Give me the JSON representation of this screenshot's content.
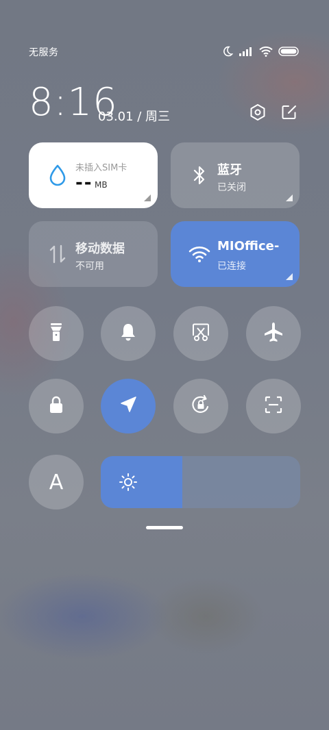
{
  "status_bar": {
    "carrier": "无服务",
    "icons": [
      "moon-icon",
      "signal-icon",
      "wifi-icon",
      "battery-icon"
    ]
  },
  "header": {
    "time": "8:16",
    "date": "03.01 / 周三",
    "icons": [
      "settings-hex-icon",
      "edit-icon"
    ]
  },
  "tiles": {
    "data": {
      "small": "未插入SIM卡",
      "value": "--",
      "unit": "MB",
      "icon": "water-drop-icon"
    },
    "bluetooth": {
      "title": "蓝牙",
      "subtitle": "已关闭",
      "icon": "bluetooth-icon"
    },
    "mobile": {
      "title": "移动数据",
      "subtitle": "不可用",
      "icon": "updown-arrows-icon"
    },
    "wifi": {
      "title": "MIOffice-",
      "subtitle": "已连接",
      "icon": "wifi-icon"
    }
  },
  "toggles": [
    {
      "name": "flashlight",
      "icon": "flashlight-icon",
      "active": false
    },
    {
      "name": "bell",
      "icon": "bell-icon",
      "active": false
    },
    {
      "name": "screenshot",
      "icon": "scissor-screenshot-icon",
      "active": false
    },
    {
      "name": "airplane",
      "icon": "airplane-icon",
      "active": false
    },
    {
      "name": "lock",
      "icon": "lock-icon",
      "active": false
    },
    {
      "name": "location",
      "icon": "location-arrow-icon",
      "active": true
    },
    {
      "name": "rotation-lock",
      "icon": "rotation-lock-icon",
      "active": false
    },
    {
      "name": "scanner",
      "icon": "scan-icon",
      "active": false
    },
    {
      "name": "auto-brightness",
      "label": "A",
      "icon": "letter-a-icon",
      "active": false
    }
  ],
  "brightness": {
    "level": 0.41,
    "icon": "sun-icon"
  },
  "colors": {
    "accent": "#5b86d6",
    "tile_white": "#ffffff",
    "drop": "#2f9ae8"
  }
}
